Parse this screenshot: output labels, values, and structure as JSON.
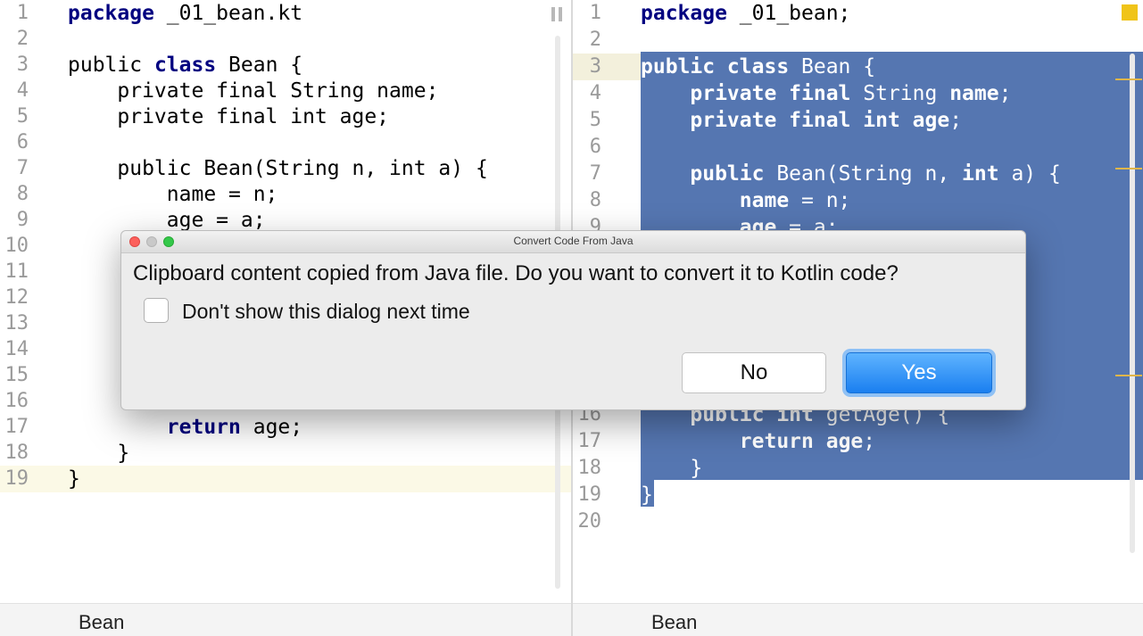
{
  "left_editor": {
    "lines": [
      {
        "n": "1",
        "t": [
          [
            "kw",
            "package"
          ],
          [
            "",
            "_01_bean.kt"
          ]
        ]
      },
      {
        "n": "2",
        "t": []
      },
      {
        "n": "3",
        "t": [
          [
            "",
            "public "
          ],
          [
            "kw",
            "class"
          ],
          [
            "",
            " Bean {"
          ]
        ]
      },
      {
        "n": "4",
        "t": [
          [
            "",
            "    private final String name;"
          ]
        ]
      },
      {
        "n": "5",
        "t": [
          [
            "",
            "    private final int age;"
          ]
        ]
      },
      {
        "n": "6",
        "t": []
      },
      {
        "n": "7",
        "t": [
          [
            "",
            "    public Bean(String n, int a) {"
          ]
        ]
      },
      {
        "n": "8",
        "t": [
          [
            "",
            "        name = n;"
          ]
        ]
      },
      {
        "n": "9",
        "t": [
          [
            "",
            "        age = a;"
          ]
        ]
      },
      {
        "n": "10",
        "t": []
      },
      {
        "n": "11",
        "t": []
      },
      {
        "n": "12",
        "t": []
      },
      {
        "n": "13",
        "t": []
      },
      {
        "n": "14",
        "t": []
      },
      {
        "n": "15",
        "t": []
      },
      {
        "n": "16",
        "t": []
      },
      {
        "n": "17",
        "t": [
          [
            "",
            "        "
          ],
          [
            "kw",
            "return"
          ],
          [
            "",
            " age;"
          ]
        ]
      },
      {
        "n": "18",
        "t": [
          [
            "",
            "    }"
          ]
        ]
      },
      {
        "n": "19",
        "t": [
          [
            "",
            "}"
          ]
        ]
      }
    ],
    "tab_label": "Bean"
  },
  "right_editor": {
    "lines": [
      {
        "n": "1",
        "t": [
          [
            "kw",
            "package"
          ],
          [
            "",
            " _01_bean;"
          ]
        ]
      },
      {
        "n": "2",
        "t": []
      },
      {
        "n": "3",
        "t": [
          [
            "kw",
            "public class"
          ],
          [
            "",
            " Bean {"
          ]
        ]
      },
      {
        "n": "4",
        "t": [
          [
            "",
            "    "
          ],
          [
            "kw",
            "private final"
          ],
          [
            "",
            " String "
          ],
          [
            "fld",
            "name"
          ],
          [
            "",
            ";"
          ]
        ]
      },
      {
        "n": "5",
        "t": [
          [
            "",
            "    "
          ],
          [
            "kw",
            "private final int"
          ],
          [
            "",
            " "
          ],
          [
            "fld",
            "age"
          ],
          [
            "",
            ";"
          ]
        ]
      },
      {
        "n": "6",
        "t": []
      },
      {
        "n": "7",
        "t": [
          [
            "",
            "    "
          ],
          [
            "kw",
            "public"
          ],
          [
            "",
            " Bean(String n, "
          ],
          [
            "kw",
            "int"
          ],
          [
            "",
            " a) {"
          ]
        ]
      },
      {
        "n": "8",
        "t": [
          [
            "",
            "        "
          ],
          [
            "fld",
            "name"
          ],
          [
            "",
            " = n;"
          ]
        ]
      },
      {
        "n": "9",
        "t": [
          [
            "",
            "        "
          ],
          [
            "fld",
            "age"
          ],
          [
            "",
            " = a;"
          ]
        ]
      },
      {
        "n": "16",
        "t": [
          [
            "",
            "    "
          ],
          [
            "kw",
            "public int"
          ],
          [
            "",
            " getAge() {"
          ]
        ]
      },
      {
        "n": "17",
        "t": [
          [
            "",
            "        "
          ],
          [
            "kw",
            "return"
          ],
          [
            "",
            " "
          ],
          [
            "fld",
            "age"
          ],
          [
            "",
            ";"
          ]
        ]
      },
      {
        "n": "18",
        "t": [
          [
            "",
            "    }"
          ]
        ]
      },
      {
        "n": "19",
        "t": [
          [
            "",
            "}"
          ]
        ]
      },
      {
        "n": "20",
        "t": []
      }
    ],
    "tab_label": "Bean"
  },
  "dialog": {
    "title": "Convert Code From Java",
    "message": "Clipboard content copied from Java file. Do you want to convert it to Kotlin code?",
    "checkbox_label": "Don't show this dialog next time",
    "checkbox_checked": false,
    "no_label": "No",
    "yes_label": "Yes"
  },
  "colors": {
    "keyword": "#000080",
    "selection": "#3d63a6",
    "current_line": "#fbf9e6",
    "primary_button": "#1a7ff0",
    "warning": "#f0c419"
  }
}
